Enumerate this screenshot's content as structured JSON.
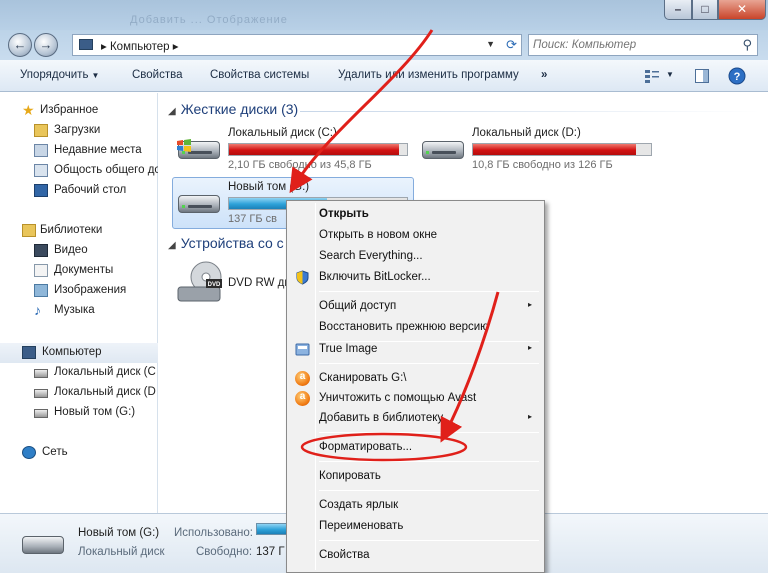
{
  "titlebar": {
    "blurred_text": "Добавить   ...   Отображение"
  },
  "address": {
    "crumb_separator": "▸",
    "path": "Компьютер",
    "trailing": "▸"
  },
  "search": {
    "placeholder": "Поиск: Компьютер"
  },
  "toolbar": {
    "organize": "Упорядочить",
    "properties": "Свойства",
    "system_properties": "Свойства системы",
    "uninstall": "Удалить или изменить программу",
    "more": "»"
  },
  "nav": {
    "favorites": "Избранное",
    "downloads": "Загрузки",
    "recent": "Недавние места",
    "shared": "Общость общего до",
    "desktop": "Рабочий стол",
    "libraries": "Библиотеки",
    "video": "Видео",
    "documents": "Документы",
    "images": "Изображения",
    "music": "Музыка",
    "computer": "Компьютер",
    "local_c": "Локальный диск (C",
    "local_d": "Локальный диск (D",
    "new_vol": "Новый том (G:)",
    "network": "Сеть"
  },
  "content": {
    "hdd_group": "Жесткие диски (3)",
    "devices_group": "Устройства со с",
    "drives": [
      {
        "name": "Локальный диск (C:)",
        "free": "2,10 ГБ свободно из 45,8 ГБ",
        "used_fraction": 0.955
      },
      {
        "name": "Локальный диск (D:)",
        "free": "10,8 ГБ свободно из 126 ГБ",
        "used_fraction": 0.914
      },
      {
        "name": "Новый том (G:)",
        "free": "137 ГБ св",
        "used_fraction": 0.55
      }
    ],
    "dvd": "DVD RW ди"
  },
  "details": {
    "name": "Новый том (G:)",
    "type": "Локальный диск",
    "used_label": "Использовано:",
    "free_label": "Свободно:",
    "free_value": "137 Г"
  },
  "context_menu": {
    "open": "Открыть",
    "open_new": "Открыть в новом окне",
    "search_everything": "Search Everything...",
    "bitlocker": "Включить BitLocker...",
    "sharing": "Общий доступ",
    "restore": "Восстановить прежнюю версию",
    "true_image": "True Image",
    "scan": "Сканировать G:\\",
    "destroy": "Уничтожить с помощью Avast",
    "add_library": "Добавить в библиотеку",
    "format": "Форматировать...",
    "copy": "Копировать",
    "shortcut": "Создать ярлык",
    "rename": "Переименовать",
    "props": "Свойства",
    "submenu_arrow": "▸"
  },
  "colors": {
    "accent_red": "#d21313",
    "annotation_red": "#e0201a"
  }
}
